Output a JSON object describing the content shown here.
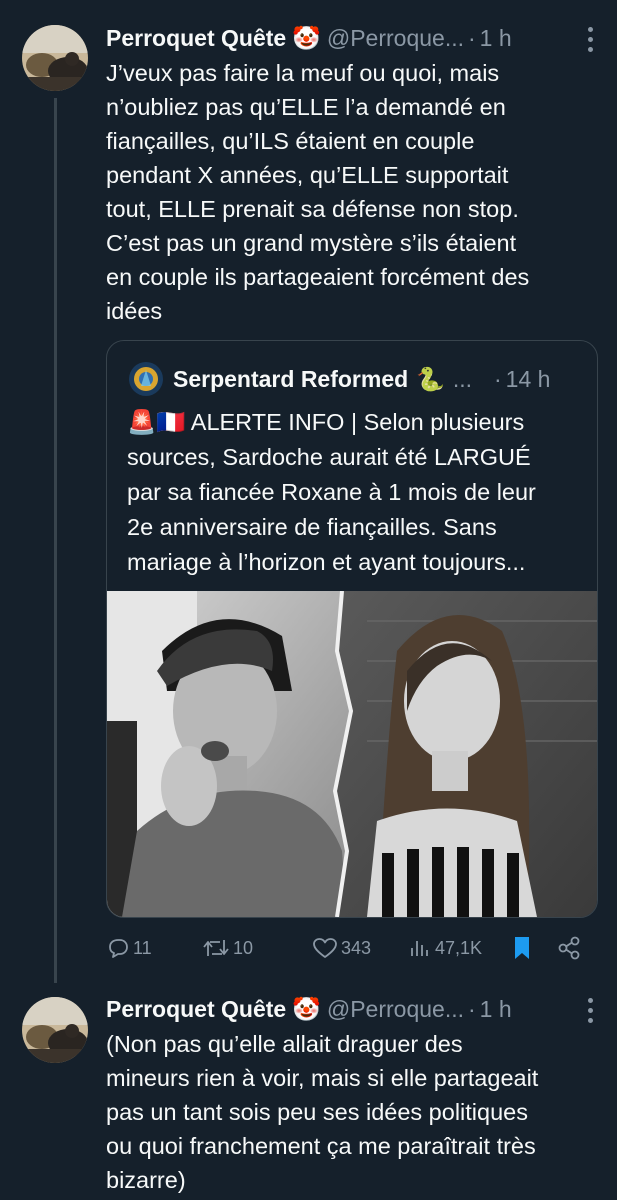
{
  "tweet1": {
    "name": "Perroquet Quête",
    "name_emoji": "🤡",
    "handle": "@Perroque...",
    "separator": "·",
    "time": "1 h",
    "text": "J’veux pas faire la meuf ou quoi, mais\nn’oubliez pas qu’ELLE l’a demandé en\nfiançailles, qu’ILS étaient en couple\npendant X années, qu’ELLE supportait\ntout, ELLE prenait sa défense non stop.\nC’est pas un grand mystère s’ils étaient\nen couple ils partageaient forcément des\nidées"
  },
  "quote": {
    "name": "Serpentard Reformed",
    "name_emoji": "🐍",
    "ellipsis": "...",
    "separator": "·",
    "time": "14 h",
    "flags": "🚨🇫🇷",
    "text": " ALERTE INFO | Selon plusieurs\nsources, Sardoche aurait été LARGUÉ\npar sa fiancée Roxane à 1 mois de leur\n2e anniversaire de fiançailles. Sans\nmariage à l’horizon et ayant toujours..."
  },
  "actions": {
    "replies": "11",
    "retweets": "10",
    "likes": "343",
    "views": "47,1K",
    "icons": [
      "reply-icon",
      "retweet-icon",
      "like-icon",
      "views-icon",
      "bookmark-icon",
      "share-icon"
    ],
    "bookmark_color": "#1d9bf0"
  },
  "tweet2": {
    "name": "Perroquet Quête",
    "name_emoji": "🤡",
    "handle": "@Perroque...",
    "separator": "·",
    "time": "1 h",
    "text": "(Non pas qu’elle allait draguer des\nmineurs rien à voir, mais si elle partageait\npas un tant sois peu ses idées politiques\nou quoi franchement ça me paraîtrait très\nbizarre)"
  }
}
